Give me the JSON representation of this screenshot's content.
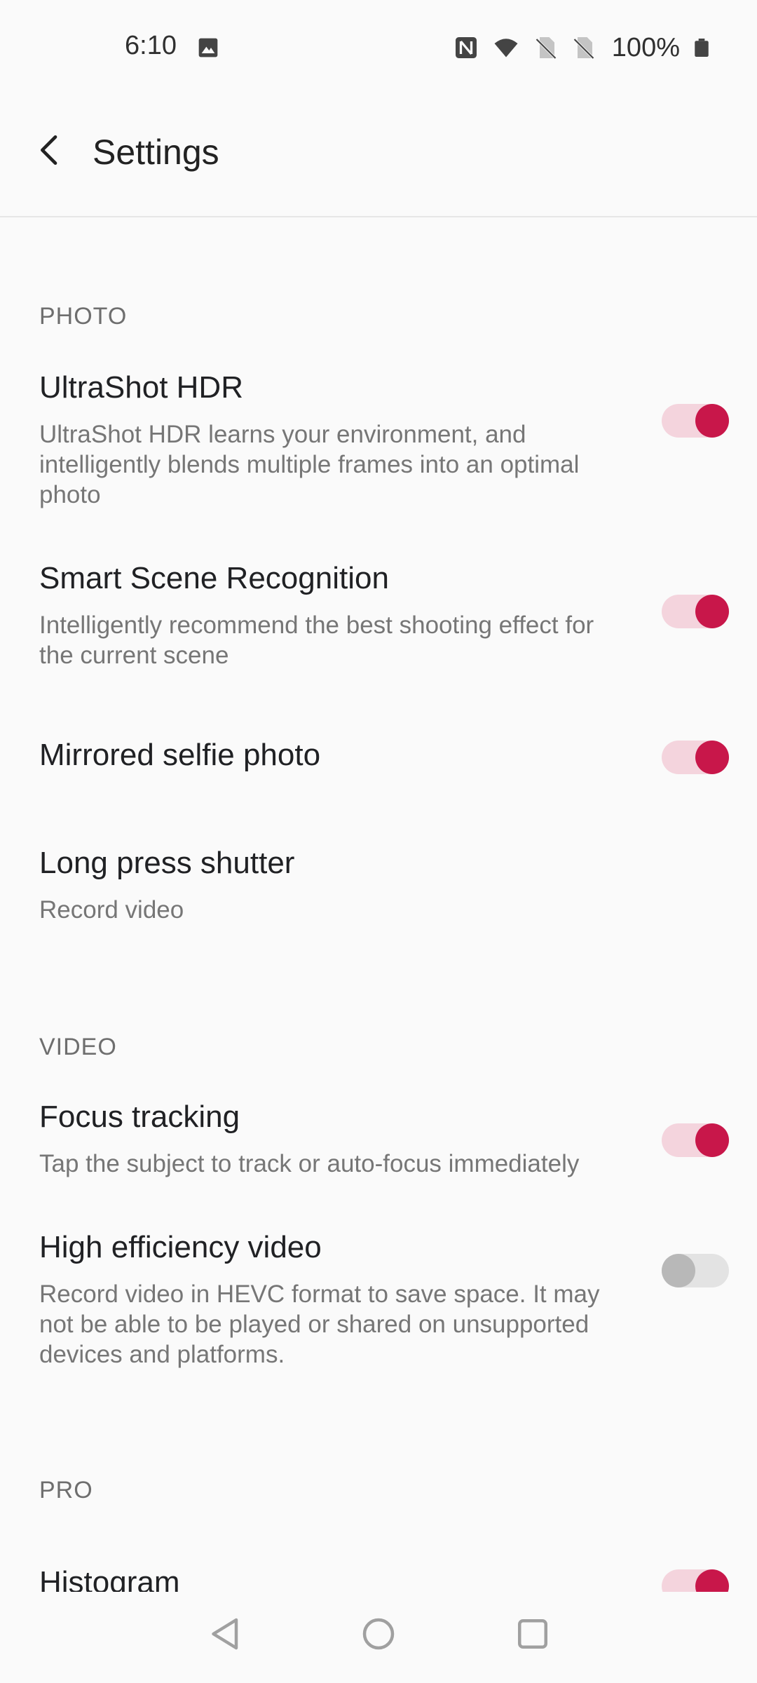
{
  "status_bar": {
    "time": "6:10",
    "battery": "100%",
    "left_icons": [
      "image-icon"
    ],
    "right_icons": [
      "nfc-icon",
      "wifi-icon",
      "no-sim-icon",
      "no-sim-icon",
      "battery-icon"
    ]
  },
  "header": {
    "title": "Settings",
    "back_icon": "back-arrow-icon"
  },
  "sections": {
    "photo": {
      "label": "PHOTO",
      "items": [
        {
          "title": "UltraShot HDR",
          "subtitle": "UltraShot HDR learns your environment, and intelligently blends multiple frames into an optimal photo",
          "enabled": true
        },
        {
          "title": "Smart Scene Recognition",
          "subtitle": "Intelligently recommend the best shooting effect for the current scene",
          "enabled": true
        },
        {
          "title": "Mirrored selfie photo",
          "enabled": true
        },
        {
          "title": "Long press shutter",
          "subtitle": "Record video"
        }
      ]
    },
    "video": {
      "label": "VIDEO",
      "items": [
        {
          "title": "Focus tracking",
          "subtitle": "Tap the subject to track or auto-focus immediately",
          "enabled": true
        },
        {
          "title": "High efficiency video",
          "subtitle": "Record video in HEVC format to save space. It may not be able to be played or shared on unsupported devices and platforms.",
          "enabled": false
        }
      ]
    },
    "pro": {
      "label": "PRO",
      "items": [
        {
          "title": "Histogram",
          "enabled": true
        }
      ]
    }
  },
  "colors": {
    "accent": "#c8174a",
    "accent_track": "#f4d4dd",
    "off_knob": "#b8b8b8",
    "off_track": "#e3e3e3",
    "background": "#fafafa"
  },
  "nav_bar": {
    "icons": [
      "back-triangle-icon",
      "home-circle-icon",
      "recents-square-icon"
    ]
  }
}
